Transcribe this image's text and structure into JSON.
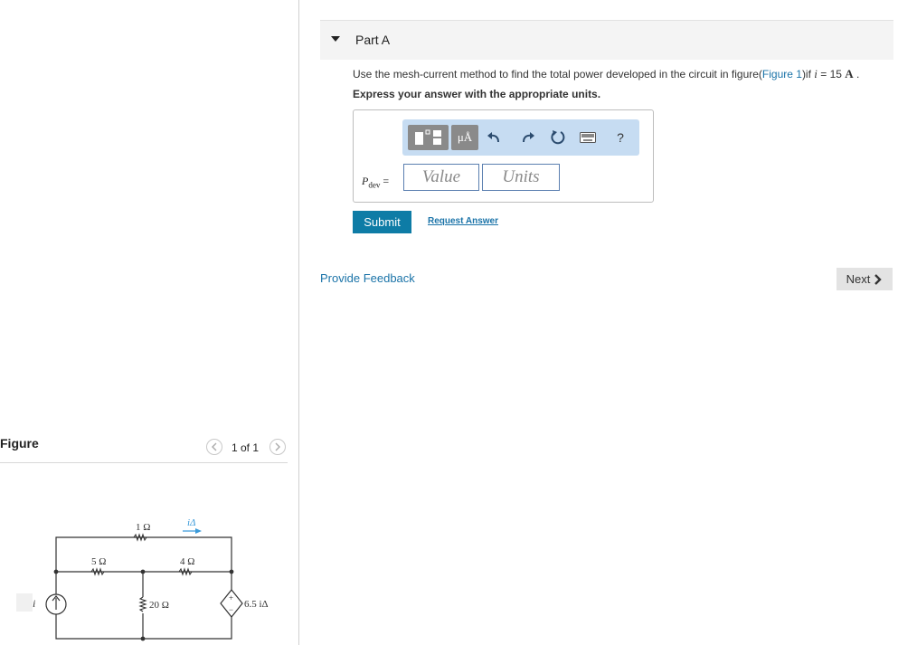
{
  "part": {
    "title": "Part A"
  },
  "question": {
    "text_before": "Use the mesh-current method to find the total power developed in the circuit in figure(",
    "link": "Figure 1",
    "text_after": ")if ",
    "variable": "i",
    "equals": " = 15 ",
    "unit": "A",
    "period": " ."
  },
  "instruction": "Express your answer with the appropriate units.",
  "toolbar": {
    "mu_label": "μÅ",
    "help_label": "?",
    "icons": [
      "templates-icon",
      "units-icon",
      "undo-icon",
      "redo-icon",
      "reset-icon",
      "keyboard-icon",
      "help-icon"
    ]
  },
  "answer": {
    "var_main": "P",
    "var_sub": "dev",
    "equals": " =",
    "value_placeholder": "Value",
    "units_placeholder": "Units"
  },
  "actions": {
    "submit": "Submit",
    "request_answer": "Request Answer",
    "provide_feedback": "Provide Feedback",
    "next": "Next"
  },
  "figure": {
    "label": "Figure",
    "count": "1 of 1",
    "circuit": {
      "r1": "1 Ω",
      "r5": "5 Ω",
      "r4": "4 Ω",
      "r20": "20 Ω",
      "current_arrow": "iΔ",
      "source_i": "i",
      "dep_source": "6.5 iΔ",
      "plus": "+",
      "minus": "−"
    }
  },
  "colors": {
    "accent": "#0e7ca6",
    "link": "#1a73a8",
    "toolbar": "#c6dcf2",
    "arrow": "#3a9ad9"
  }
}
